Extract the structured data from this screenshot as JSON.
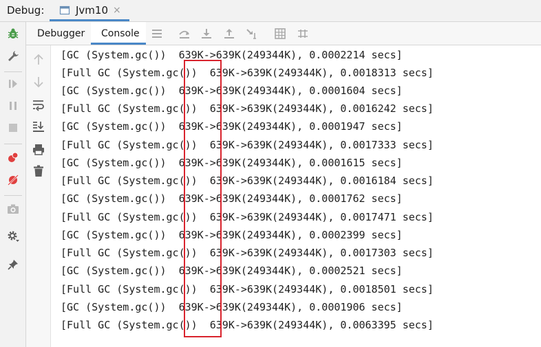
{
  "header": {
    "debug_label": "Debug:",
    "tab": {
      "label": "Jvm10",
      "close": "×"
    }
  },
  "toolbar": {
    "tabs": [
      {
        "label": "Debugger",
        "active": false
      },
      {
        "label": "Console",
        "active": true
      }
    ]
  },
  "console": {
    "lines": [
      "[GC (System.gc())  639K->639K(249344K), 0.0002214 secs]",
      "[Full GC (System.gc())  639K->639K(249344K), 0.0018313 secs]",
      "[GC (System.gc())  639K->639K(249344K), 0.0001604 secs]",
      "[Full GC (System.gc())  639K->639K(249344K), 0.0016242 secs]",
      "[GC (System.gc())  639K->639K(249344K), 0.0001947 secs]",
      "[Full GC (System.gc())  639K->639K(249344K), 0.0017333 secs]",
      "[GC (System.gc())  639K->639K(249344K), 0.0001615 secs]",
      "[Full GC (System.gc())  639K->639K(249344K), 0.0016184 secs]",
      "[GC (System.gc())  639K->639K(249344K), 0.0001762 secs]",
      "[Full GC (System.gc())  639K->639K(249344K), 0.0017471 secs]",
      "[GC (System.gc())  639K->639K(249344K), 0.0002399 secs]",
      "[Full GC (System.gc())  639K->639K(249344K), 0.0017303 secs]",
      "[GC (System.gc())  639K->639K(249344K), 0.0002521 secs]",
      "[Full GC (System.gc())  639K->639K(249344K), 0.0018501 secs]",
      "[GC (System.gc())  639K->639K(249344K), 0.0001906 secs]",
      "[Full GC (System.gc())  639K->639K(249344K), 0.0063395 secs]"
    ]
  },
  "colors": {
    "accent": "#4a88c7",
    "highlight": "#d9232d",
    "debug_bug": "#4a9c4a",
    "breakpoint": "#e0403f"
  },
  "icons": {
    "left_rail": [
      "bug-icon",
      "wrench-icon",
      "resume-icon",
      "pause-icon",
      "stop-icon",
      "view-breakpoints-icon",
      "mute-breakpoints-icon",
      "camera-icon",
      "settings-icon",
      "pin-icon"
    ],
    "toolbar": [
      "menu-icon",
      "step-over-icon",
      "step-into-icon",
      "step-out-icon",
      "run-to-cursor-icon",
      "evaluate-icon",
      "trace-icon"
    ],
    "gutter": [
      "up-arrow-icon",
      "down-arrow-icon",
      "soft-wrap-icon",
      "scroll-to-end-icon",
      "print-icon",
      "trash-icon"
    ]
  }
}
